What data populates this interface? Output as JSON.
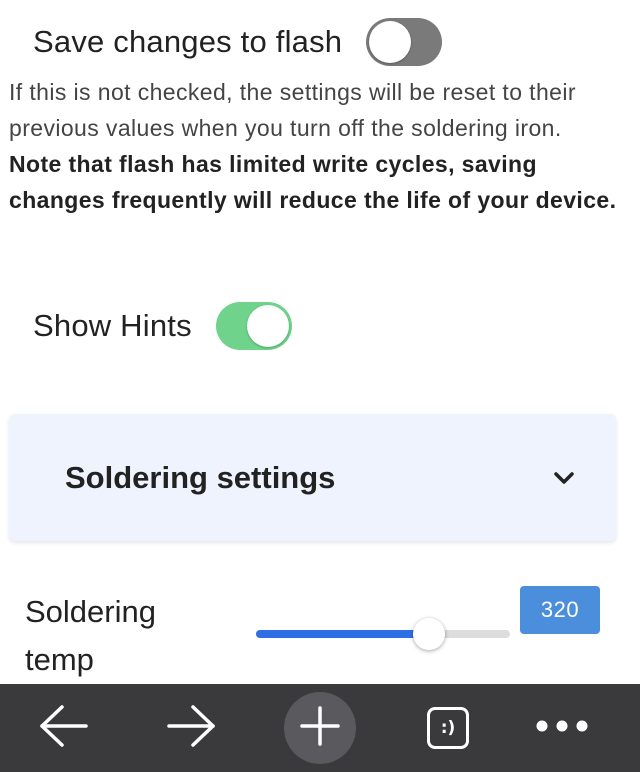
{
  "settings": {
    "save_to_flash": {
      "label": "Save changes to flash",
      "enabled": false
    },
    "help": {
      "text": "If this is not checked, the settings will be reset to their previous values when you turn off the soldering iron. ",
      "warning": "Note that flash has limited write cycles, saving changes frequently will reduce the life of your device."
    },
    "show_hints": {
      "label": "Show Hints",
      "enabled": true
    }
  },
  "accordion": {
    "title": "Soldering settings",
    "icon": "chevron-down-icon"
  },
  "soldering_temp": {
    "label": "Soldering temp",
    "value": "320",
    "fill_fraction": 0.68
  },
  "bottom_bar": {
    "icons": [
      "back-arrow-icon",
      "forward-arrow-icon",
      "plus-icon",
      "tabs-face-icon",
      "more-icon"
    ],
    "tabs_label": ":)"
  },
  "colors": {
    "toggle_off": "#7a7a7a",
    "toggle_on": "#6fd38b",
    "accent": "#2f6fe6",
    "value_badge": "#4a8edc",
    "accordion_bg": "#eef3fd",
    "bottom_bar": "#3a3a3c"
  }
}
